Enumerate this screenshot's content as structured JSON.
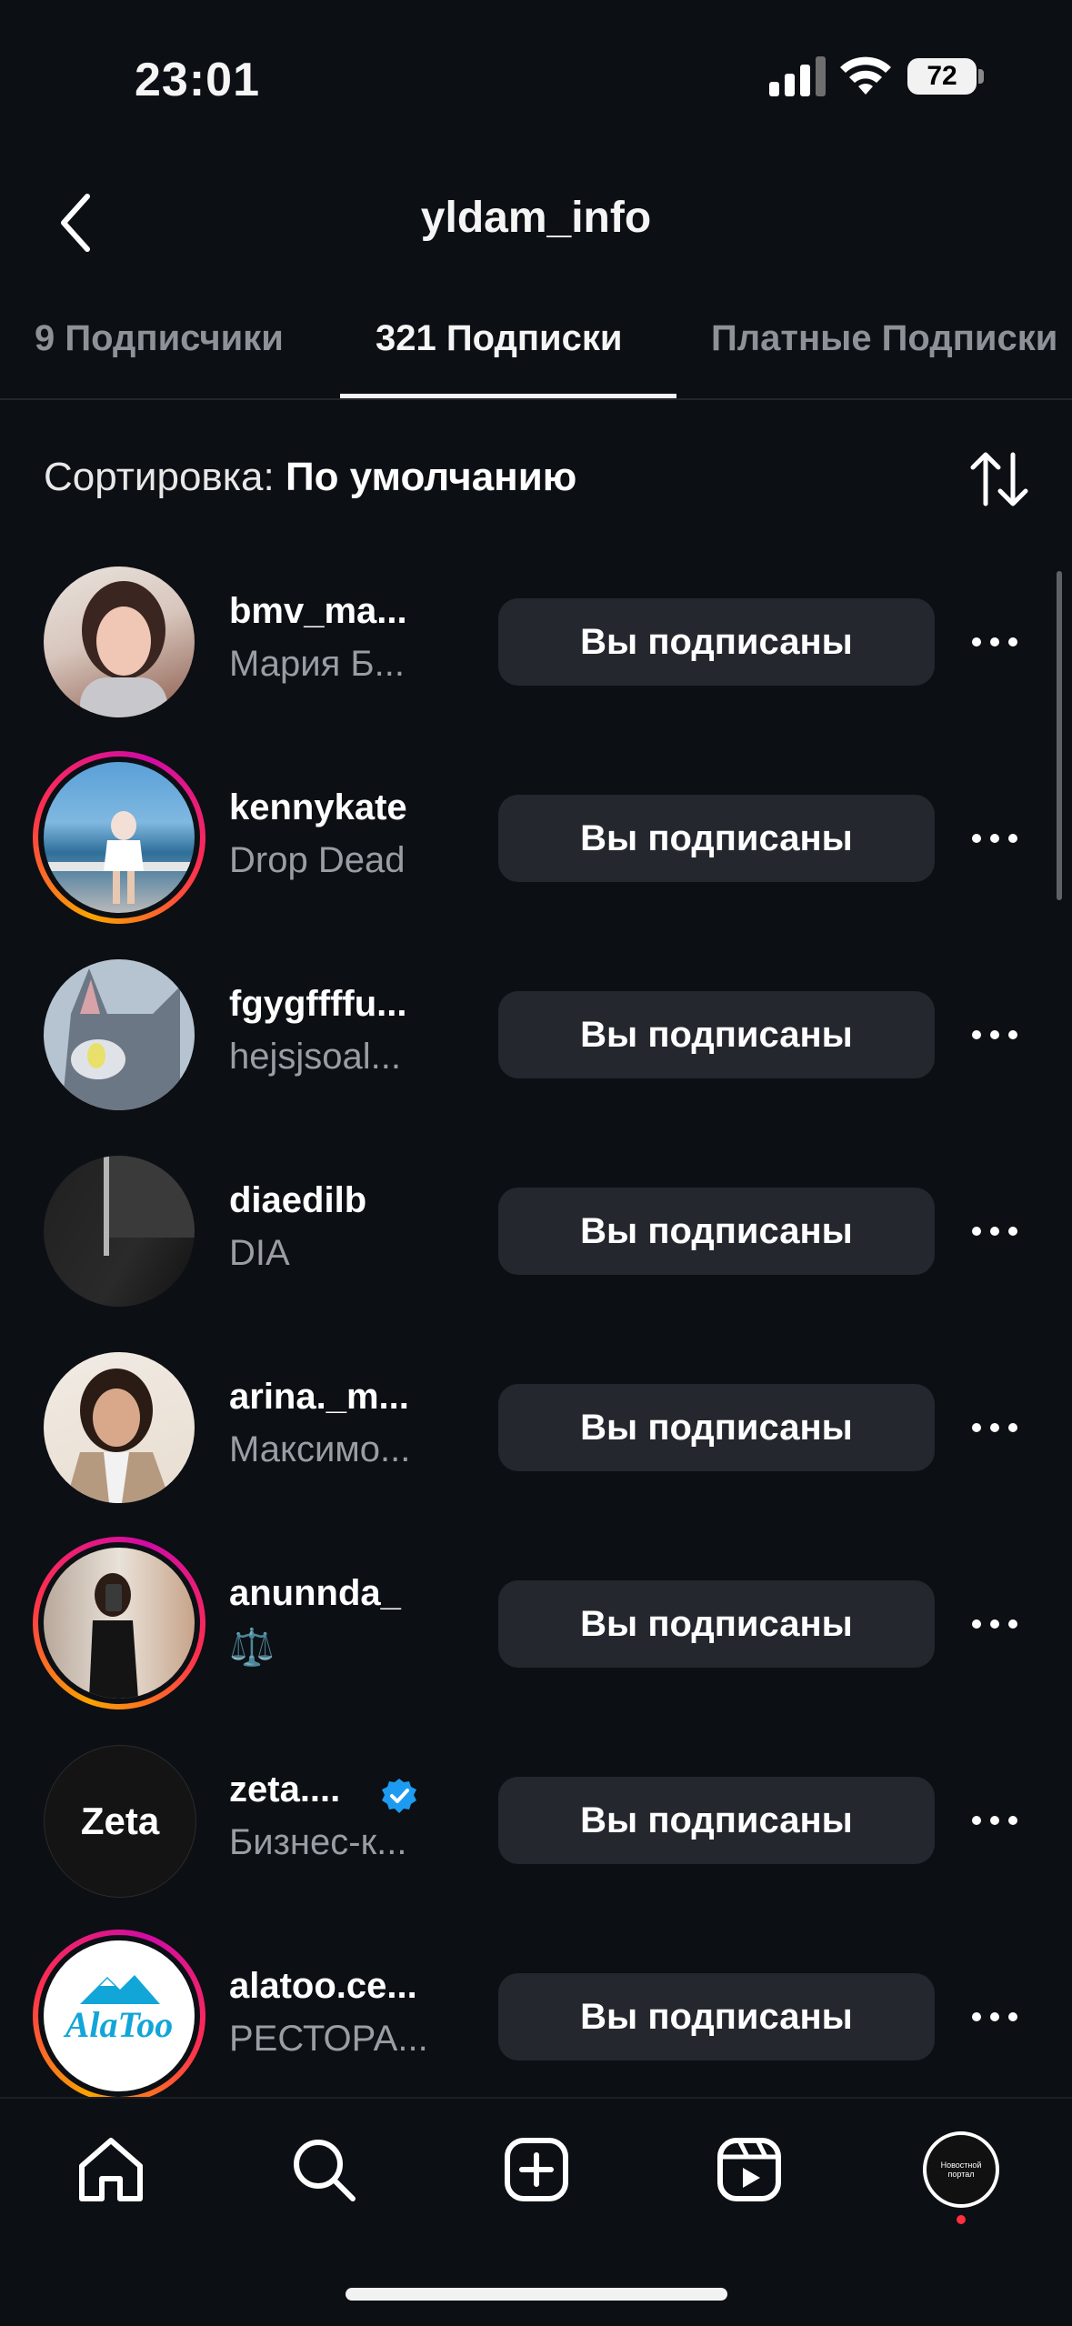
{
  "status": {
    "time": "23:01",
    "battery": "72"
  },
  "header": {
    "title": "yldam_info"
  },
  "tabs": [
    {
      "label": "9 Подписчики"
    },
    {
      "label": "321 Подписки"
    },
    {
      "label": "Платные Подписки"
    }
  ],
  "sort": {
    "label": "Сортировка: ",
    "value": "По умолчанию"
  },
  "follow_label": "Вы подписаны",
  "rows": [
    {
      "username": "bmv_ma...",
      "name": "Мария Б..."
    },
    {
      "username": "kennykate",
      "name": "Drop Dead"
    },
    {
      "username": "fgygffffu...",
      "name": "hejsjsoal..."
    },
    {
      "username": "diaedilb",
      "name": "DIA"
    },
    {
      "username": "arina._m...",
      "name": "Максимо..."
    },
    {
      "username": "anunnda_",
      "name": "⚖️"
    },
    {
      "username": "zeta....",
      "name": "Бизнес-к..."
    },
    {
      "username": "alatoo.ce...",
      "name": "РЕСТОРА..."
    }
  ],
  "avatars": {
    "zeta_text": "Zeta",
    "alatoo_text": "AlaToo",
    "profile_text": "Новостной портал"
  }
}
